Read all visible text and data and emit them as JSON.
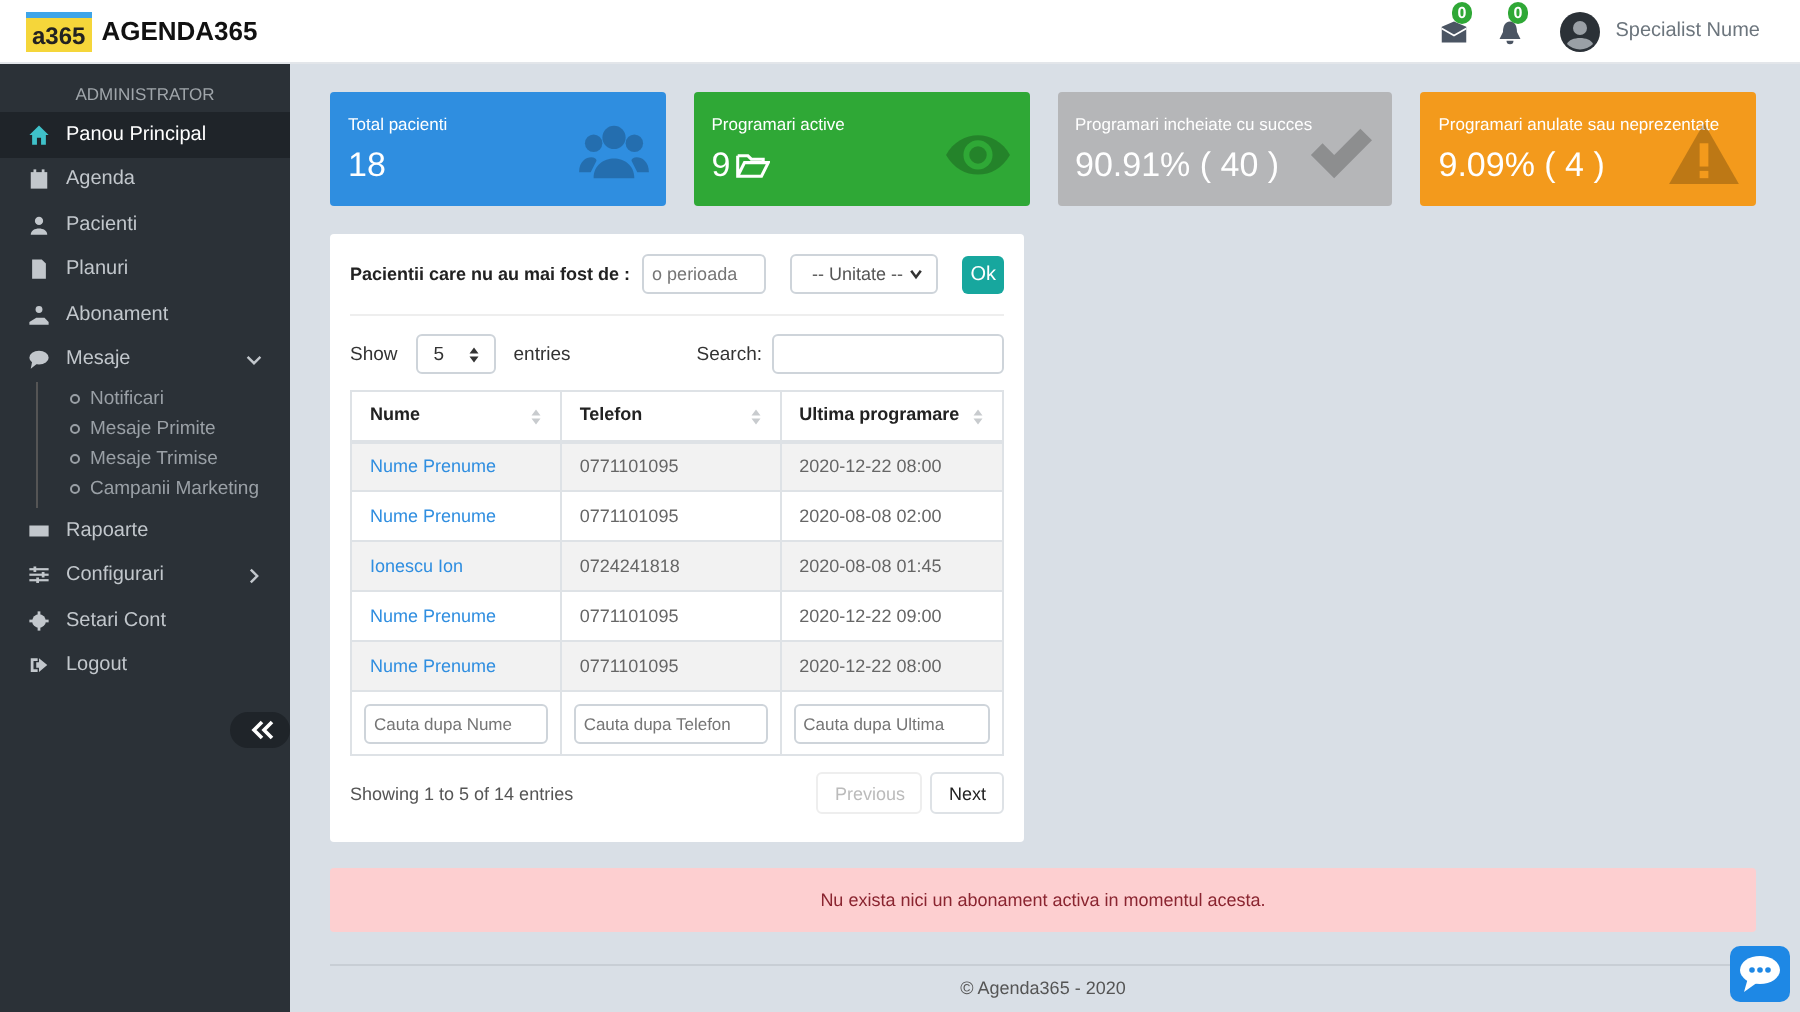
{
  "header": {
    "logo_mark": "a365",
    "brand": "AGENDA365",
    "messages_badge": "0",
    "notifications_badge": "0",
    "user_name": "Specialist Nume"
  },
  "sidebar": {
    "section": "ADMINISTRATOR",
    "items": [
      {
        "label": "Panou Principal",
        "selected": true
      },
      {
        "label": "Agenda",
        "selected": false
      },
      {
        "label": "Pacienti",
        "selected": false
      },
      {
        "label": "Planuri",
        "selected": false
      },
      {
        "label": "Abonament",
        "selected": false
      },
      {
        "label": "Mesaje",
        "selected": false,
        "expanded": true,
        "children": [
          {
            "label": "Notificari"
          },
          {
            "label": "Mesaje Primite"
          },
          {
            "label": "Mesaje Trimise"
          },
          {
            "label": "Campanii Marketing"
          }
        ]
      },
      {
        "label": "Rapoarte",
        "selected": false
      },
      {
        "label": "Configurari",
        "selected": false,
        "expanded": false
      },
      {
        "label": "Setari Cont",
        "selected": false
      },
      {
        "label": "Logout",
        "selected": false
      }
    ]
  },
  "stats": [
    {
      "title": "Total pacienti",
      "value": "18",
      "color": "#2f8ee0"
    },
    {
      "title": "Programari active",
      "value": "9",
      "color": "#2fa836"
    },
    {
      "title": "Programari incheiate cu succes",
      "value": "90.91% ( 40 )",
      "color": "#b5b6b8"
    },
    {
      "title": "Programari anulate sau neprezentate",
      "value": "9.09% ( 4 )",
      "color": "#f39a1c"
    }
  ],
  "filter": {
    "label": "Pacientii care nu au mai fost de :",
    "period_placeholder": "o perioada",
    "unit_select": "-- Unitate --",
    "ok_button": "Ok"
  },
  "table": {
    "show_label": "Show",
    "page_size": "5",
    "entries_label": "entries",
    "search_label": "Search:",
    "columns": [
      "Nume",
      "Telefon",
      "Ultima programare"
    ],
    "rows": [
      [
        "Nume Prenume",
        "0771101095",
        "2020-12-22 08:00"
      ],
      [
        "Nume Prenume",
        "0771101095",
        "2020-08-08 02:00"
      ],
      [
        "Ionescu Ion",
        "0724241818",
        "2020-08-08 01:45"
      ],
      [
        "Nume Prenume",
        "0771101095",
        "2020-12-22 09:00"
      ],
      [
        "Nume Prenume",
        "0771101095",
        "2020-12-22 08:00"
      ]
    ],
    "column_filter_placeholders": [
      "Cauta dupa Nume",
      "Cauta dupa Telefon",
      "Cauta dupa Ultima"
    ],
    "info": "Showing 1 to 5 of 14 entries",
    "pagination": [
      {
        "label": "Previous",
        "disabled": true
      },
      {
        "label": "Next",
        "disabled": false
      }
    ]
  },
  "alert": "Nu exista nici un abonament activa in momentul acesta.",
  "footer": "© Agenda365 - 2020"
}
